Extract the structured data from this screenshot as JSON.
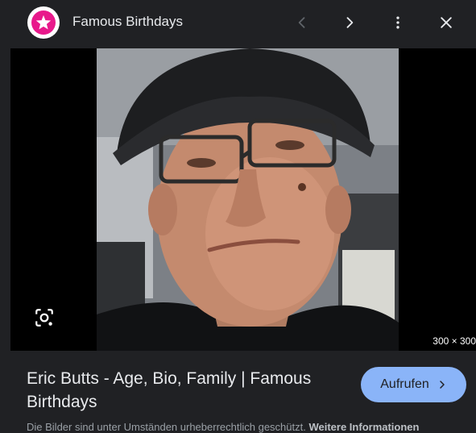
{
  "header": {
    "site_name": "Famous Birthdays",
    "logo_icon": "star-icon",
    "logo_color": "#e8198b"
  },
  "image": {
    "dimensions": "300 × 300",
    "lens_icon": "google-lens-icon"
  },
  "result": {
    "title": "Eric Butts - Age, Bio, Family | Famous Birthdays",
    "visit_label": "Aufrufen",
    "notice_text": "Die Bilder sind unter Umständen urheberrechtlich geschützt.",
    "notice_link": "Weitere Informationen"
  },
  "colors": {
    "background": "#202124",
    "accent": "#8ab4f8"
  }
}
